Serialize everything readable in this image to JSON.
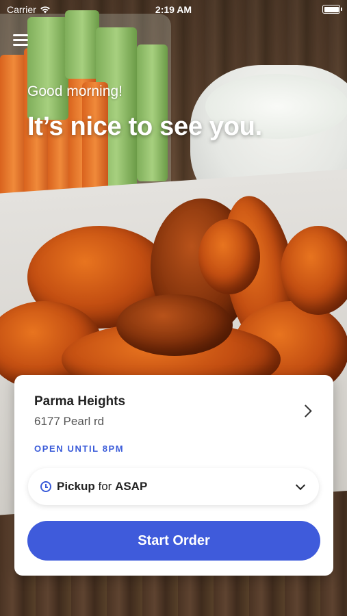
{
  "status_bar": {
    "carrier": "Carrier",
    "time": "2:19 AM"
  },
  "hero": {
    "greeting": "Good morning!",
    "headline": "It’s nice to see you."
  },
  "location": {
    "name": "Parma Heights",
    "address": "6177 Pearl rd",
    "hours_status": "OPEN UNTIL 8PM"
  },
  "order_mode": {
    "mode": "Pickup",
    "connector": "for",
    "time": "ASAP"
  },
  "actions": {
    "start_order_label": "Start Order"
  },
  "colors": {
    "accent": "#3f5bdb",
    "card_bg": "#ffffff"
  },
  "icons": [
    "wifi-icon",
    "battery-icon",
    "menu-icon",
    "chevron-right-icon",
    "clock-icon",
    "chevron-down-icon"
  ]
}
